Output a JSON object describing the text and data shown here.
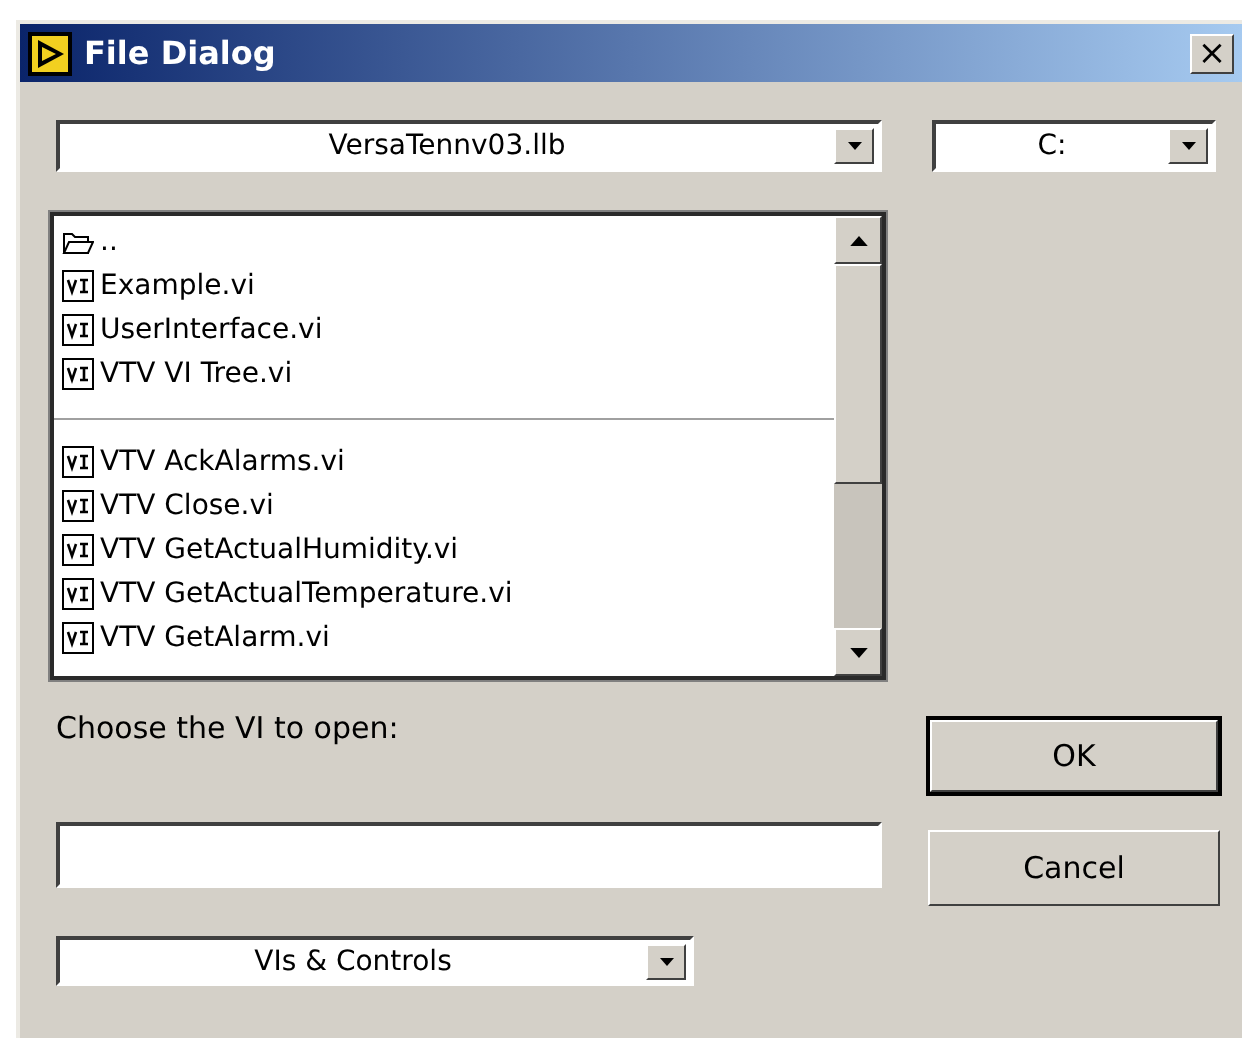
{
  "window": {
    "title": "File Dialog",
    "close": "×"
  },
  "path_dropdown": {
    "value": "VersaTennv03.llb"
  },
  "drive_dropdown": {
    "value": "C:"
  },
  "file_list": {
    "groups": [
      [
        {
          "kind": "folder",
          "label": ".."
        },
        {
          "kind": "vi",
          "label": "Example.vi"
        },
        {
          "kind": "vi",
          "label": "UserInterface.vi"
        },
        {
          "kind": "vi",
          "label": "VTV VI Tree.vi"
        }
      ],
      [
        {
          "kind": "vi",
          "label": "VTV AckAlarms.vi"
        },
        {
          "kind": "vi",
          "label": "VTV Close.vi"
        },
        {
          "kind": "vi",
          "label": "VTV GetActualHumidity.vi"
        },
        {
          "kind": "vi",
          "label": "VTV GetActualTemperature.vi"
        },
        {
          "kind": "vi",
          "label": "VTV GetAlarm.vi"
        }
      ]
    ]
  },
  "prompt": "Choose the VI to open:",
  "filter_dropdown": {
    "value": "VIs & Controls"
  },
  "buttons": [
    {
      "label": "OK",
      "default": true
    },
    {
      "label": "Cancel",
      "default": false
    }
  ]
}
